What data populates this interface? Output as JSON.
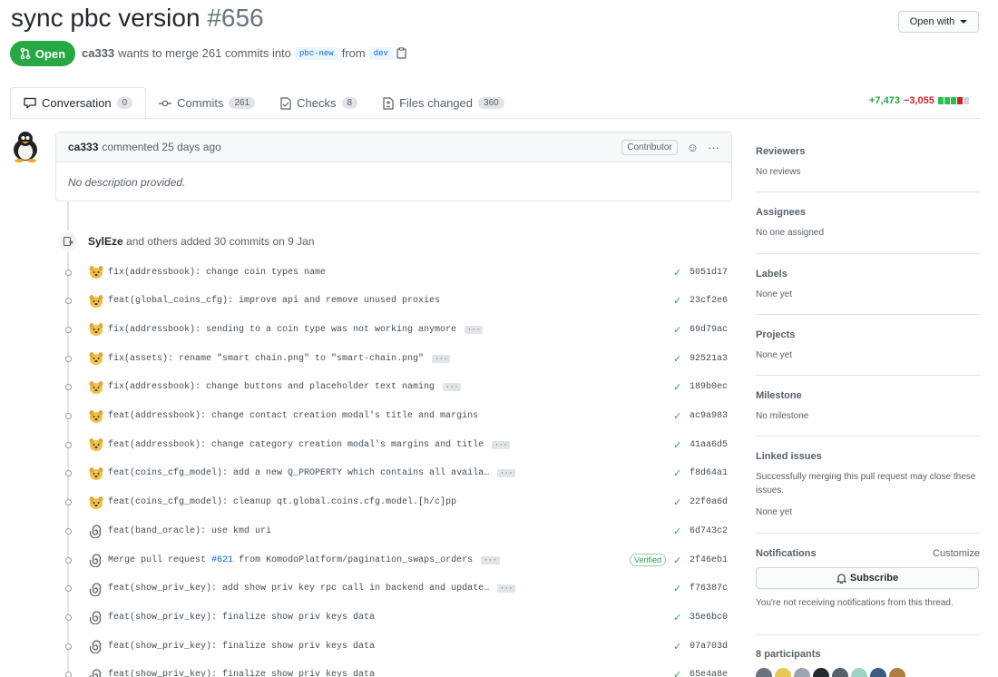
{
  "header": {
    "title": "sync pbc version",
    "number": "#656",
    "open_with": "Open with",
    "state": "Open",
    "author": "ca333",
    "merge_text": "wants to merge 261 commits into",
    "base_branch": "pbc-new",
    "from_text": "from",
    "head_branch": "dev"
  },
  "tabs": [
    {
      "label": "Conversation",
      "count": "0"
    },
    {
      "label": "Commits",
      "count": "261"
    },
    {
      "label": "Checks",
      "count": "8"
    },
    {
      "label": "Files changed",
      "count": "360"
    }
  ],
  "diffstat": {
    "additions": "+7,473",
    "deletions": "−3,055"
  },
  "comment": {
    "author": "ca333",
    "action": "commented 25 days ago",
    "role": "Contributor",
    "body": "No description provided."
  },
  "timeline": {
    "author": "SylEze",
    "text": "and others added 30 commits on 9 Jan"
  },
  "commits": [
    {
      "avatar": "dog",
      "message": "fix(addressbook): change coin types name",
      "ellipsis": false,
      "sha": "5051d17",
      "verified": false
    },
    {
      "avatar": "dog",
      "message": "feat(global_coins_cfg): improve api and remove unused proxies",
      "ellipsis": false,
      "sha": "23cf2e6",
      "verified": false
    },
    {
      "avatar": "dog",
      "message": "fix(addressbook): sending to a coin type was not working anymore",
      "ellipsis": true,
      "sha": "69d79ac",
      "verified": false
    },
    {
      "avatar": "dog",
      "message": "fix(assets): rename \"smart chain.png\" to \"smart-chain.png\"",
      "ellipsis": true,
      "sha": "92521a3",
      "verified": false
    },
    {
      "avatar": "dog",
      "message": "fix(addressbook): change buttons and placeholder text naming",
      "ellipsis": true,
      "sha": "189b0ec",
      "verified": false
    },
    {
      "avatar": "dog",
      "message": "feat(addressbook): change contact creation modal's title and margins",
      "ellipsis": false,
      "sha": "ac9a983",
      "verified": false
    },
    {
      "avatar": "dog",
      "message": "feat(addressbook): change category creation modal's margins and title",
      "ellipsis": true,
      "sha": "41aa6d5",
      "verified": false
    },
    {
      "avatar": "dog",
      "message": "feat(coins_cfg_model): add a new Q_PROPERTY which contains all availa…",
      "ellipsis": true,
      "sha": "f8d64a1",
      "verified": false
    },
    {
      "avatar": "dog",
      "message": "feat(coins_cfg_model): cleanup qt.global.coins.cfg.model.[h/c]pp",
      "ellipsis": false,
      "sha": "22f0a6d",
      "verified": false
    },
    {
      "avatar": "spiral",
      "message": "feat(band_oracle): use kmd uri",
      "ellipsis": false,
      "sha": "6d743c2",
      "verified": false
    },
    {
      "avatar": "spiral",
      "message_pre": "Merge pull request",
      "message_link": "#621",
      "message_post": "from KomodoPlatform/pagination_swaps_orders",
      "ellipsis": true,
      "sha": "2f46eb1",
      "verified": true,
      "verified_label": "Verified"
    },
    {
      "avatar": "spiral",
      "message": "feat(show_priv_key): add show priv key rpc call in backend and update…",
      "ellipsis": true,
      "sha": "f76387c",
      "verified": false
    },
    {
      "avatar": "spiral",
      "message": "feat(show_priv_key): finalize show priv keys data",
      "ellipsis": false,
      "sha": "35e6bc0",
      "verified": false
    },
    {
      "avatar": "spiral",
      "message": "feat(show_priv_key): finalize show priv keys data",
      "ellipsis": false,
      "sha": "07a703d",
      "verified": false
    },
    {
      "avatar": "spiral",
      "message": "feat(show_priv_key): finalize show priv keys data",
      "ellipsis": false,
      "sha": "65e4a8e",
      "verified": false
    }
  ],
  "sidebar": {
    "reviewers": {
      "title": "Reviewers",
      "value": "No reviews"
    },
    "assignees": {
      "title": "Assignees",
      "value": "No one assigned"
    },
    "labels": {
      "title": "Labels",
      "value": "None yet"
    },
    "projects": {
      "title": "Projects",
      "value": "None yet"
    },
    "milestone": {
      "title": "Milestone",
      "value": "No milestone"
    },
    "linked": {
      "title": "Linked issues",
      "desc": "Successfully merging this pull request may close these issues.",
      "value": "None yet"
    },
    "notifications": {
      "title": "Notifications",
      "customize": "Customize",
      "subscribe": "Subscribe",
      "desc": "You're not receiving notifications from this thread."
    },
    "participants": {
      "title": "8 participants"
    }
  },
  "colors": {
    "open_green": "#28a745",
    "link_blue": "#0366d6",
    "deletion_red": "#cb2431"
  }
}
